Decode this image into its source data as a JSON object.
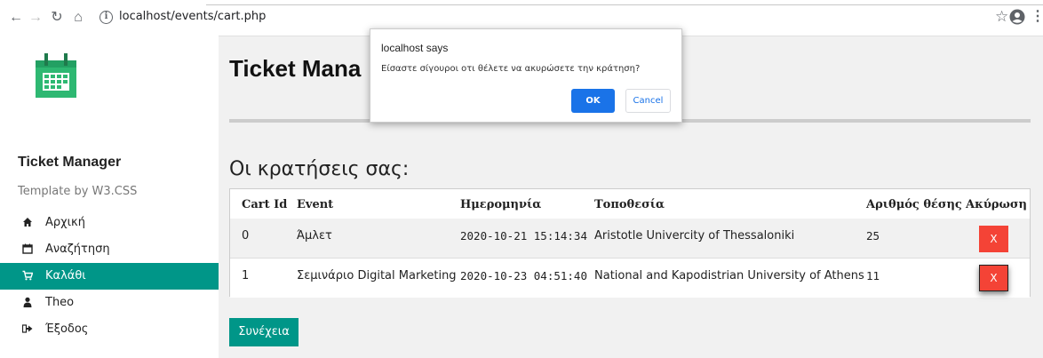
{
  "browser": {
    "url": "localhost/events/cart.php"
  },
  "sidebar": {
    "title": "Ticket Manager",
    "subtitle": "Template by W3.CSS",
    "items": [
      {
        "label": "Αρχική",
        "icon": "home-icon"
      },
      {
        "label": "Αναζήτηση",
        "icon": "calendar-icon"
      },
      {
        "label": "Καλάθι",
        "icon": "cart-icon",
        "active": true
      },
      {
        "label": "Theo",
        "icon": "user-icon"
      },
      {
        "label": "Έξοδος",
        "icon": "sign-out-icon"
      }
    ]
  },
  "main": {
    "title": "Ticket Mana",
    "subtitle": "Οι κρατήσεις σας:",
    "continue_label": "Συνέχεια"
  },
  "table": {
    "headers": [
      "Cart Id",
      "Event",
      "Ημερομηνία",
      "Τοποθεσία",
      "Αριθμός θέσης",
      "Ακύρωση"
    ],
    "rows": [
      {
        "id": "0",
        "event": "Άμλετ",
        "date": "2020-10-21 15:14:34",
        "location": "Aristotle Univercity of Thessaloniki",
        "seat": "25",
        "cancel": "X"
      },
      {
        "id": "1",
        "event": "Σεμινάριο Digital Marketing",
        "date": "2020-10-23 04:51:40",
        "location": "National and Kapodistrian University of Athens",
        "seat": "11",
        "cancel": "X"
      }
    ]
  },
  "dialog": {
    "title": "localhost says",
    "message": "Είσαστε σίγουροι οτι θέλετε να ακυρώσετε την κράτηση?",
    "ok_label": "OK",
    "cancel_label": "Cancel"
  },
  "colors": {
    "accent": "#009688",
    "danger": "#f44336",
    "dialog_primary": "#1a73e8"
  }
}
